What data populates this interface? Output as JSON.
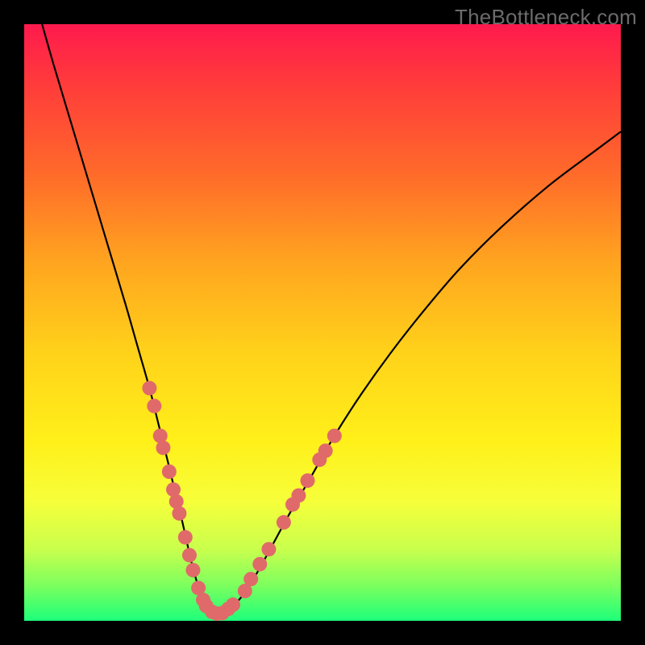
{
  "watermark": "TheBottleneck.com",
  "chart_data": {
    "type": "line",
    "title": "",
    "xlabel": "",
    "ylabel": "",
    "xlim": [
      0,
      100
    ],
    "ylim": [
      0,
      100
    ],
    "grid": false,
    "legend": false,
    "series": [
      {
        "name": "bottleneck-curve",
        "color": "#000000",
        "x": [
          3,
          5,
          8,
          11,
          14,
          17,
          19,
          21,
          22.5,
          24,
          25.2,
          26.3,
          27.2,
          28,
          28.8,
          29.6,
          30.4,
          31.3,
          32.3,
          33.5,
          35,
          36.8,
          39,
          41.5,
          44.5,
          48,
          52,
          56.5,
          61.5,
          67,
          73,
          80,
          88,
          96,
          100
        ],
        "y": [
          100,
          93,
          83,
          73,
          63,
          53,
          46,
          39,
          33,
          27,
          22,
          17.5,
          13.5,
          10,
          7,
          4.5,
          2.8,
          1.7,
          1.2,
          1.5,
          2.5,
          4.5,
          8,
          12.5,
          18,
          24,
          31,
          38,
          45,
          52,
          59,
          66,
          73,
          79,
          82
        ]
      }
    ],
    "scatter_points": {
      "name": "highlighted-data-points",
      "color": "#e06a6a",
      "points": [
        {
          "x": 21.0,
          "y": 39
        },
        {
          "x": 21.8,
          "y": 36
        },
        {
          "x": 22.8,
          "y": 31
        },
        {
          "x": 23.3,
          "y": 29
        },
        {
          "x": 24.3,
          "y": 25
        },
        {
          "x": 25.0,
          "y": 22
        },
        {
          "x": 25.5,
          "y": 20
        },
        {
          "x": 26.0,
          "y": 18
        },
        {
          "x": 27.0,
          "y": 14
        },
        {
          "x": 27.7,
          "y": 11
        },
        {
          "x": 28.3,
          "y": 8.5
        },
        {
          "x": 29.2,
          "y": 5.5
        },
        {
          "x": 30.0,
          "y": 3.5
        },
        {
          "x": 30.5,
          "y": 2.5
        },
        {
          "x": 31.5,
          "y": 1.5
        },
        {
          "x": 32.3,
          "y": 1.2
        },
        {
          "x": 33.2,
          "y": 1.3
        },
        {
          "x": 34.2,
          "y": 2.0
        },
        {
          "x": 35.0,
          "y": 2.7
        },
        {
          "x": 37.0,
          "y": 5.0
        },
        {
          "x": 38.0,
          "y": 7.0
        },
        {
          "x": 39.5,
          "y": 9.5
        },
        {
          "x": 41.0,
          "y": 12.0
        },
        {
          "x": 43.5,
          "y": 16.5
        },
        {
          "x": 45.0,
          "y": 19.5
        },
        {
          "x": 46.0,
          "y": 21.0
        },
        {
          "x": 47.5,
          "y": 23.5
        },
        {
          "x": 49.5,
          "y": 27.0
        },
        {
          "x": 50.5,
          "y": 28.5
        },
        {
          "x": 52.0,
          "y": 31.0
        }
      ]
    },
    "gradient_background": {
      "direction": "vertical",
      "stops": [
        {
          "pos": 0.0,
          "color": "#ff1a4d"
        },
        {
          "pos": 0.1,
          "color": "#ff3b3b"
        },
        {
          "pos": 0.25,
          "color": "#ff6a2a"
        },
        {
          "pos": 0.4,
          "color": "#ffa51f"
        },
        {
          "pos": 0.55,
          "color": "#ffd21a"
        },
        {
          "pos": 0.7,
          "color": "#fff01a"
        },
        {
          "pos": 0.8,
          "color": "#f6ff3a"
        },
        {
          "pos": 0.88,
          "color": "#c9ff4d"
        },
        {
          "pos": 0.94,
          "color": "#7dff5e"
        },
        {
          "pos": 1.0,
          "color": "#1dff7a"
        }
      ]
    }
  }
}
